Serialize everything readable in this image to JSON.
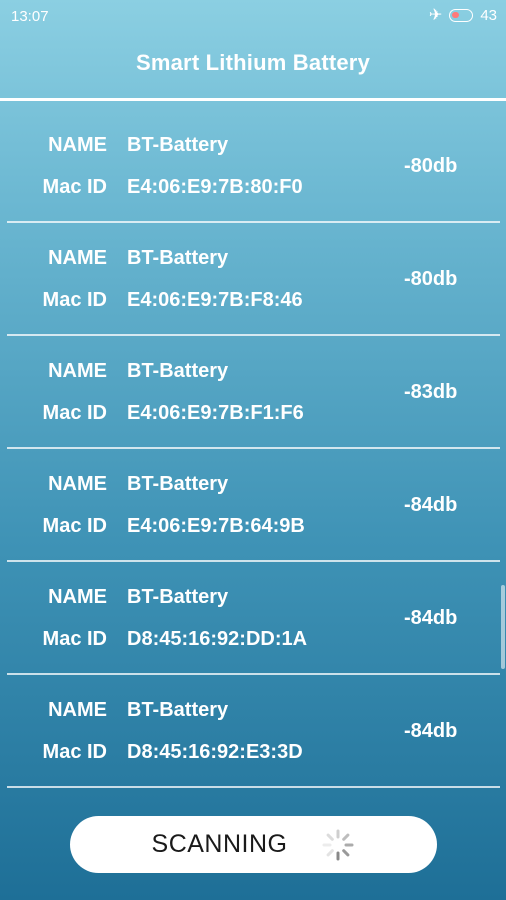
{
  "status_bar": {
    "time": "13:07",
    "battery_level": "43",
    "icons": [
      "airplane-mode-icon",
      "battery-icon"
    ]
  },
  "header": {
    "title": "Smart Lithium Battery"
  },
  "devices": [
    {
      "name_label": "NAME",
      "name": "BT-Battery",
      "mac_label": "Mac ID",
      "mac": "E4:06:E9:7B:80:F0",
      "rssi": "-80db"
    },
    {
      "name_label": "NAME",
      "name": "BT-Battery",
      "mac_label": "Mac ID",
      "mac": "E4:06:E9:7B:F8:46",
      "rssi": "-80db"
    },
    {
      "name_label": "NAME",
      "name": "BT-Battery",
      "mac_label": "Mac ID",
      "mac": "E4:06:E9:7B:F1:F6",
      "rssi": "-83db"
    },
    {
      "name_label": "NAME",
      "name": "BT-Battery",
      "mac_label": "Mac ID",
      "mac": "E4:06:E9:7B:64:9B",
      "rssi": "-84db"
    },
    {
      "name_label": "NAME",
      "name": "BT-Battery",
      "mac_label": "Mac ID",
      "mac": "D8:45:16:92:DD:1A",
      "rssi": "-84db"
    },
    {
      "name_label": "NAME",
      "name": "BT-Battery",
      "mac_label": "Mac ID",
      "mac": "D8:45:16:92:E3:3D",
      "rssi": "-84db"
    }
  ],
  "scan_button": {
    "label": "SCANNING",
    "icon": "loading-spinner-icon"
  },
  "colors": {
    "background_top": "#8bcfe2",
    "background_bottom": "#1e6f97",
    "text": "#ffffff",
    "button": "#ffffff"
  }
}
